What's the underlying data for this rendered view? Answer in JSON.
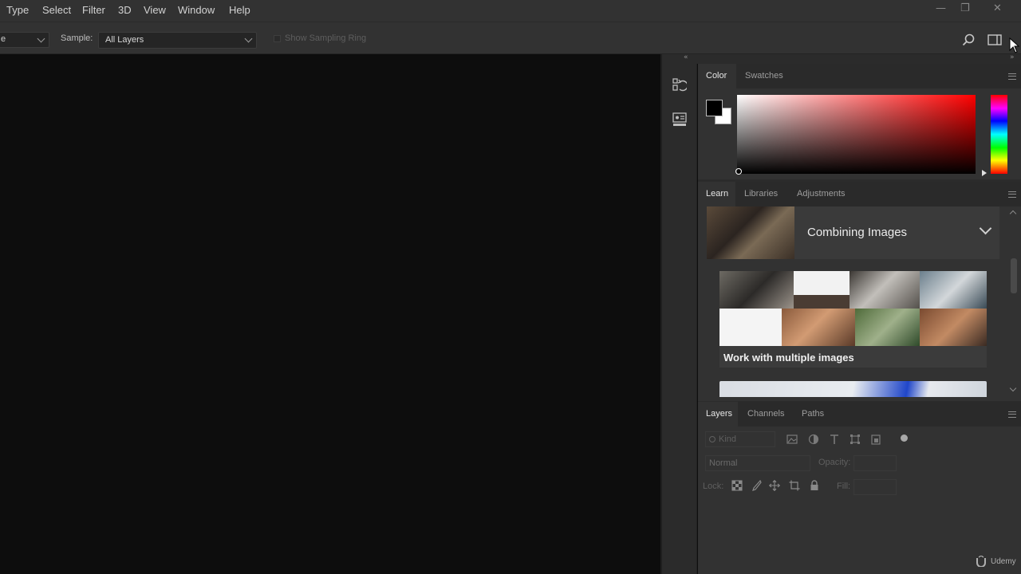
{
  "menu": {
    "items": [
      "Type",
      "Select",
      "Filter",
      "3D",
      "View",
      "Window",
      "Help"
    ]
  },
  "window_controls": {
    "minimize": "—",
    "restore": "❐",
    "close": "✕"
  },
  "options_bar": {
    "truncated_select_value": "e",
    "sample_label": "Sample:",
    "sample_value": "All Layers",
    "show_sampling_ring": {
      "label": "Show Sampling Ring",
      "checked": false
    }
  },
  "panel_collapse": {
    "left": "«",
    "right": "»"
  },
  "color_panel": {
    "tabs": [
      "Color",
      "Swatches"
    ],
    "active_tab": "Color",
    "foreground": "#000000",
    "background": "#ffffff",
    "hue": "#ff0000"
  },
  "learn_panel": {
    "tabs": [
      "Learn",
      "Libraries",
      "Adjustments"
    ],
    "active_tab": "Learn",
    "section_title": "Combining Images",
    "card_title": "Work with multiple images"
  },
  "layers_panel": {
    "tabs": [
      "Layers",
      "Channels",
      "Paths"
    ],
    "active_tab": "Layers",
    "filter_placeholder": "Kind",
    "blend_mode": "Normal",
    "opacity_label": "Opacity:",
    "lock_label": "Lock:",
    "fill_label": "Fill:"
  },
  "watermark": {
    "text": "Udemy"
  }
}
